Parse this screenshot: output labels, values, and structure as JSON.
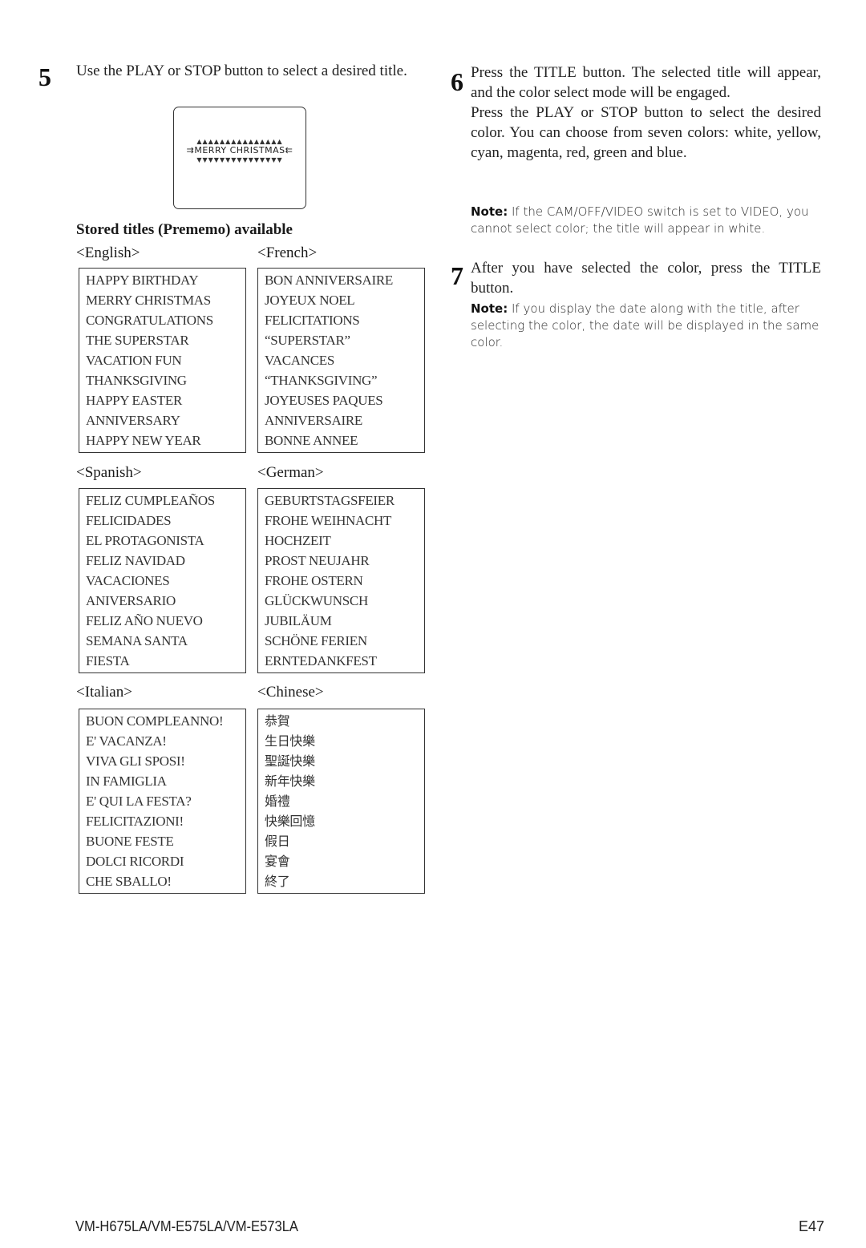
{
  "steps": [
    {
      "number": "5",
      "text": "Use the PLAY or STOP button to select a desired title."
    },
    {
      "number": "6",
      "text": "Press the TITLE button. The selected title will appear, and the color select mode will be engaged.",
      "text2": "Press the PLAY or STOP button to select the desired color. You can choose from seven colors: white, yellow, cyan, magenta, red, green and blue.",
      "note_label": "Note:",
      "note_text": "If the CAM/OFF/VIDEO switch is set to VIDEO, you cannot select color; the title will appear in white."
    },
    {
      "number": "7",
      "text": "After you have selected the color, press the TITLE button.",
      "note_label": "Note:",
      "note_text": "If you display the date along with the title, after selecting the color, the date will be displayed in the same color."
    }
  ],
  "display": {
    "title_shown": "MERRY CHRISTMAS",
    "top_decoration": "▲▲▲▲▲▲▲▲▲▲▲▲▲▲▲",
    "bottom_decoration": "▼▼▼▼▼▼▼▼▼▼▼▼▼▼▼",
    "left_decoration": "⇉",
    "right_decoration": "⇇"
  },
  "section_heading": "Stored titles (Prememo) available",
  "languages": [
    {
      "label": "<English>",
      "titles": [
        "HAPPY BIRTHDAY",
        "MERRY CHRISTMAS",
        "CONGRATULATIONS",
        "THE SUPERSTAR",
        "VACATION FUN",
        "THANKSGIVING",
        "HAPPY EASTER",
        "ANNIVERSARY",
        "HAPPY NEW YEAR"
      ]
    },
    {
      "label": "<French>",
      "titles": [
        "BON ANNIVERSAIRE",
        "JOYEUX NOEL",
        "FELICITATIONS",
        "“SUPERSTAR”",
        "VACANCES",
        "“THANKSGIVING”",
        "JOYEUSES PAQUES",
        "ANNIVERSAIRE",
        "BONNE ANNEE"
      ]
    },
    {
      "label": "<Spanish>",
      "titles": [
        "FELIZ CUMPLEAÑOS",
        "FELICIDADES",
        "EL PROTAGONISTA",
        "FELIZ NAVIDAD",
        "VACACIONES",
        "ANIVERSARIO",
        "FELIZ AÑO NUEVO",
        "SEMANA SANTA",
        "FIESTA"
      ]
    },
    {
      "label": "<German>",
      "titles": [
        "GEBURTSTAGSFEIER",
        "FROHE WEIHNACHT",
        "HOCHZEIT",
        "PROST NEUJAHR",
        "FROHE OSTERN",
        "GLÜCKWUNSCH",
        "JUBILÄUM",
        "SCHÖNE FERIEN",
        "ERNTEDANKFEST"
      ]
    },
    {
      "label": "<Italian>",
      "titles": [
        "BUON COMPLEANNO!",
        "E' VACANZA!",
        "VIVA GLI SPOSI!",
        "IN FAMIGLIA",
        "E' QUI LA FESTA?",
        "FELICITAZIONI!",
        "BUONE FESTE",
        "DOLCI RICORDI",
        "CHE SBALLO!"
      ]
    },
    {
      "label": "<Chinese>",
      "titles": [
        "恭賀",
        "生日快樂",
        "聖誕快樂",
        "新年快樂",
        "婚禮",
        "快樂回憶",
        "假日",
        "宴會",
        "終了"
      ]
    }
  ],
  "footer": {
    "model": "VM-H675LA/VM-E575LA/VM-E573LA",
    "page": "E47"
  }
}
